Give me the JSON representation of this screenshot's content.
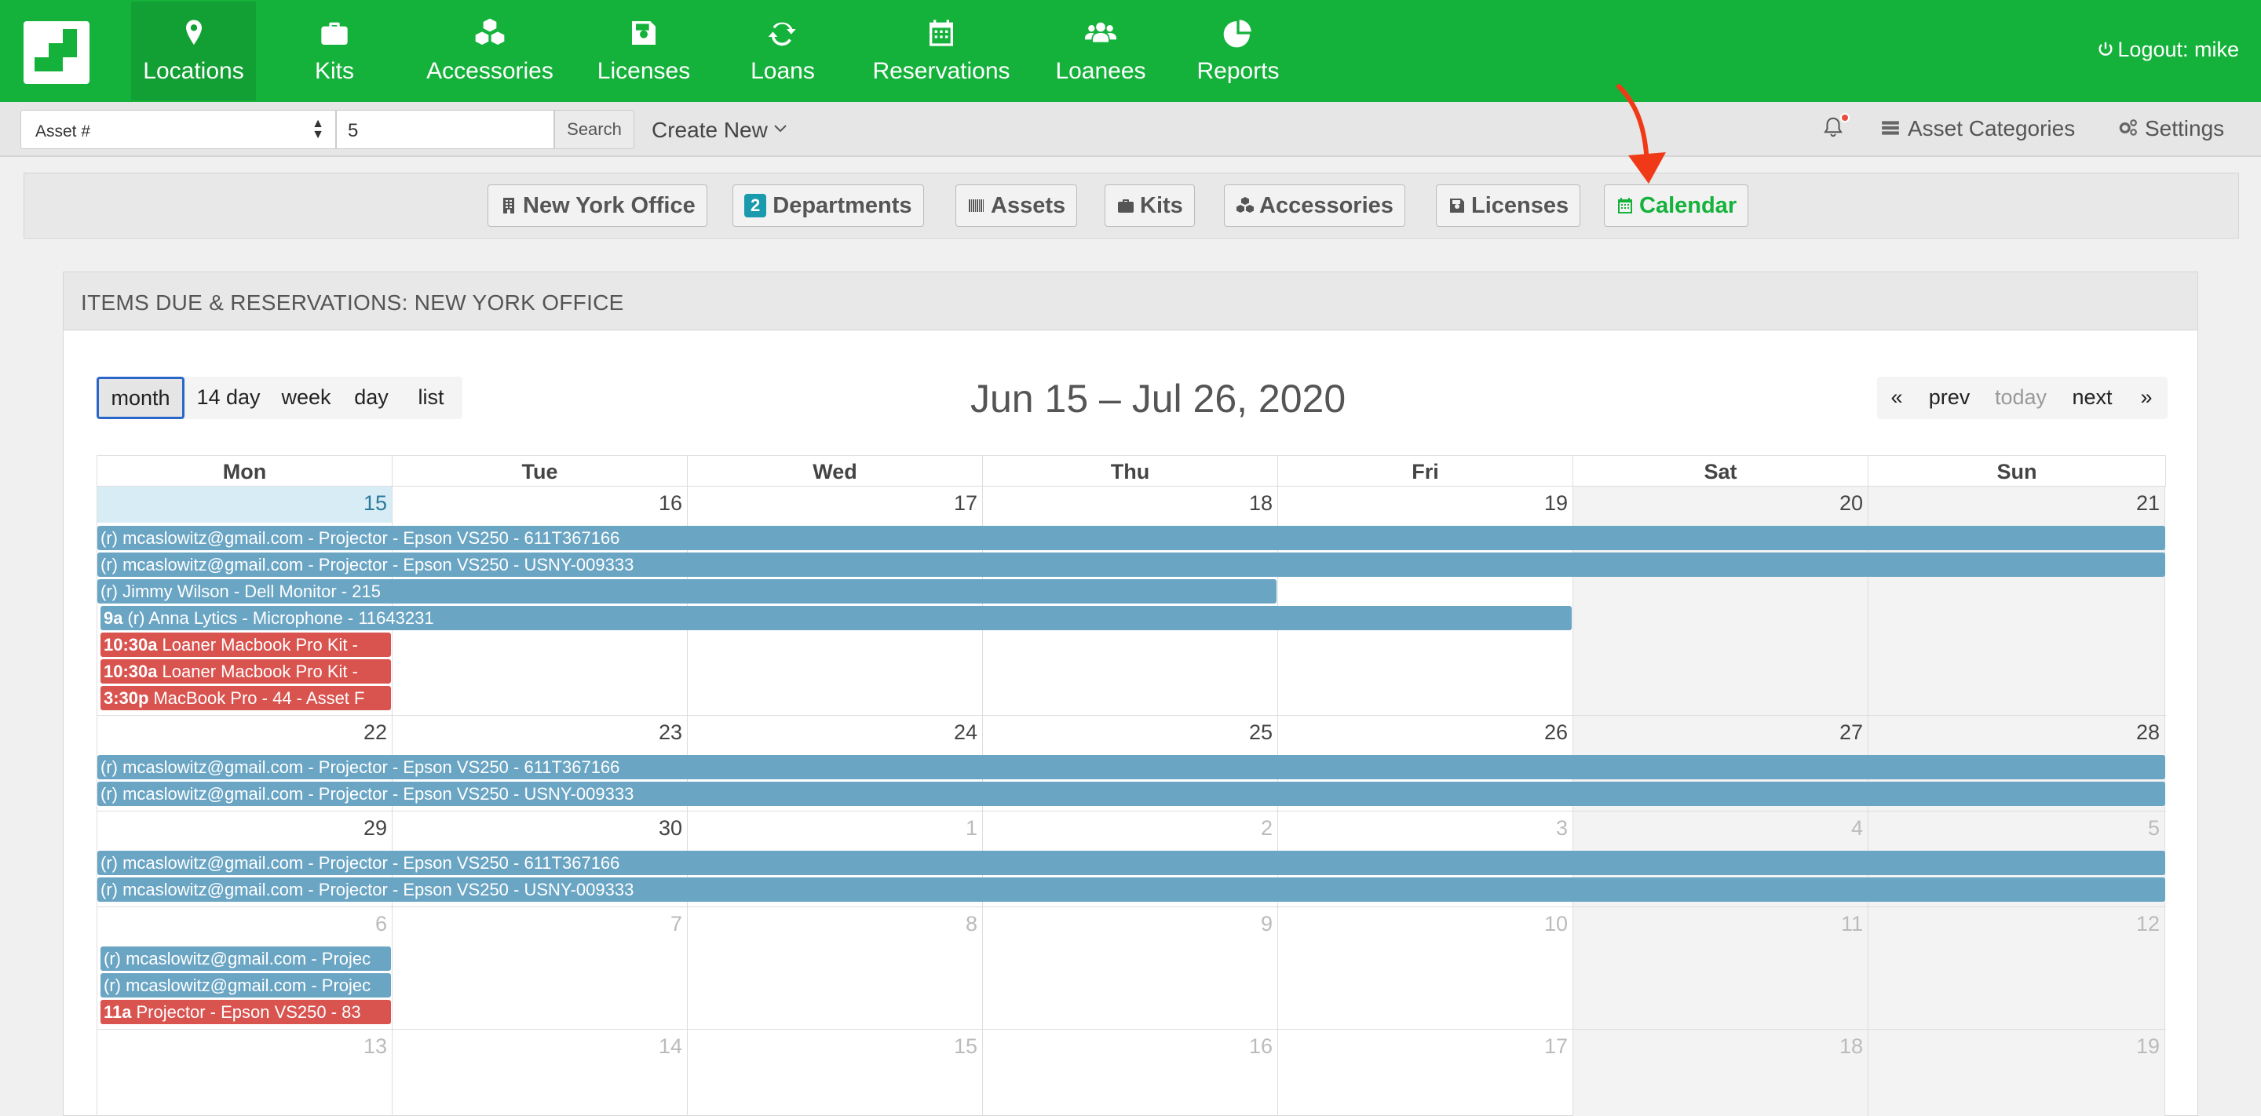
{
  "nav": {
    "items": [
      {
        "label": "Locations",
        "icon": "map-pin-icon"
      },
      {
        "label": "Kits",
        "icon": "briefcase-icon"
      },
      {
        "label": "Accessories",
        "icon": "cubes-icon"
      },
      {
        "label": "Licenses",
        "icon": "floppy-disk-icon"
      },
      {
        "label": "Loans",
        "icon": "refresh-icon"
      },
      {
        "label": "Reservations",
        "icon": "calendar-icon"
      },
      {
        "label": "Loanees",
        "icon": "users-icon"
      },
      {
        "label": "Reports",
        "icon": "pie-chart-icon"
      }
    ],
    "logout": "Logout: mike"
  },
  "search": {
    "field_selected": "Asset #",
    "value": "5",
    "button": "Search",
    "create_new": "Create New",
    "asset_categories": "Asset Categories",
    "settings": "Settings"
  },
  "subnav": {
    "office": "New York Office",
    "departments_count": "2",
    "departments": "Departments",
    "assets": "Assets",
    "kits": "Kits",
    "accessories": "Accessories",
    "licenses": "Licenses",
    "calendar": "Calendar"
  },
  "panel": {
    "title": "ITEMS DUE & RESERVATIONS: NEW YORK OFFICE"
  },
  "calendar": {
    "views": [
      "month",
      "14 day",
      "week",
      "day",
      "list"
    ],
    "active_view": "month",
    "title": "Jun 15 – Jul 26, 2020",
    "nav": {
      "first": "«",
      "prev": "prev",
      "today": "today",
      "next": "next",
      "last": "»"
    },
    "days_of_week": [
      "Mon",
      "Tue",
      "Wed",
      "Thu",
      "Fri",
      "Sat",
      "Sun"
    ],
    "weeks": [
      {
        "days": [
          "15",
          "16",
          "17",
          "18",
          "19",
          "20",
          "21"
        ]
      },
      {
        "days": [
          "22",
          "23",
          "24",
          "25",
          "26",
          "27",
          "28"
        ]
      },
      {
        "days": [
          "29",
          "30",
          "1",
          "2",
          "3",
          "4",
          "5"
        ]
      },
      {
        "days": [
          "6",
          "7",
          "8",
          "9",
          "10",
          "11",
          "12"
        ]
      },
      {
        "days": [
          "13",
          "14",
          "15",
          "16",
          "17",
          "18",
          "19"
        ]
      }
    ],
    "events": {
      "w1_e1": "(r) mcaslowitz@gmail.com - Projector - Epson VS250 - 611T367166",
      "w1_e2": "(r) mcaslowitz@gmail.com - Projector - Epson VS250 - USNY-009333",
      "w1_e3": "(r) Jimmy Wilson - Dell Monitor - 215",
      "w1_e4_time": "9a",
      "w1_e4": "(r) Anna Lytics - Microphone - 11643231",
      "w1_e5_time": "10:30a",
      "w1_e5": "Loaner Macbook Pro Kit -",
      "w1_e6_time": "10:30a",
      "w1_e6": "Loaner Macbook Pro Kit -",
      "w1_e7_time": "3:30p",
      "w1_e7": "MacBook Pro - 44 - Asset F",
      "w2_e1": "(r) mcaslowitz@gmail.com - Projector - Epson VS250 - 611T367166",
      "w2_e2": "(r) mcaslowitz@gmail.com - Projector - Epson VS250 - USNY-009333",
      "w3_e1": "(r) mcaslowitz@gmail.com - Projector - Epson VS250 - 611T367166",
      "w3_e2": "(r) mcaslowitz@gmail.com - Projector - Epson VS250 - USNY-009333",
      "w4_e1": "(r) mcaslowitz@gmail.com - Projec",
      "w4_e2": "(r) mcaslowitz@gmail.com - Projec",
      "w4_e3_time": "11a",
      "w4_e3": "Projector - Epson VS250 - 83"
    }
  },
  "colors": {
    "brand_green": "#15b23b",
    "event_blue": "#6aa5c4",
    "event_red": "#d9534f",
    "annotation_red": "#f03a17"
  }
}
